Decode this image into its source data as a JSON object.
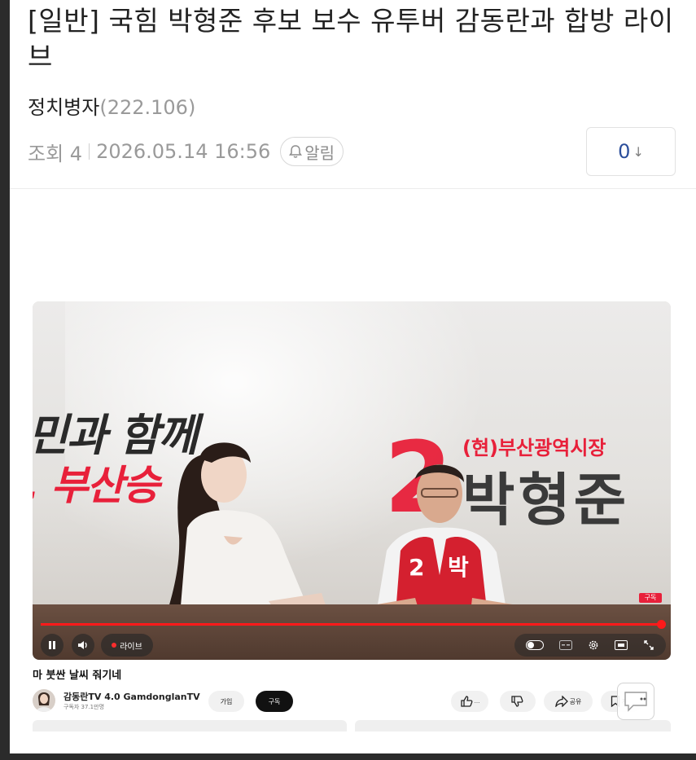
{
  "post": {
    "title": "[일반] 국힘 박형준 후보 보수 유투버 감동란과 합방 라이브",
    "author": "정치병자",
    "author_ip": "(222.106)",
    "views": "조회 4",
    "datetime": "2026.05.14 16:56",
    "alarm_label": "알림",
    "comment_count": "0",
    "comment_arrow": "↓"
  },
  "video": {
    "banner_line1": "민과 함께",
    "banner_line2": ", 부산승",
    "candidate_number": "2",
    "candidate_role": "(현)부산광역시장",
    "candidate_name": "박형준",
    "vest_text_number": "2",
    "vest_text_name": "박",
    "corner_badge": "구독",
    "progress_fraction": 0.995,
    "live_label": "라이브",
    "title": "마 붓싼 날씨 줘기네",
    "channel_name": "감동란TV 4.0 GamdonglanTV",
    "subscribers": "구독자 37.1만명",
    "join_label": "가입",
    "subscribe_label": "구독",
    "share_label": "공유",
    "save_label": "저장",
    "colors": {
      "accent_red": "#e8203a",
      "progress_red": "#ff1a1a",
      "comment_blue": "#2b4e9b"
    }
  }
}
